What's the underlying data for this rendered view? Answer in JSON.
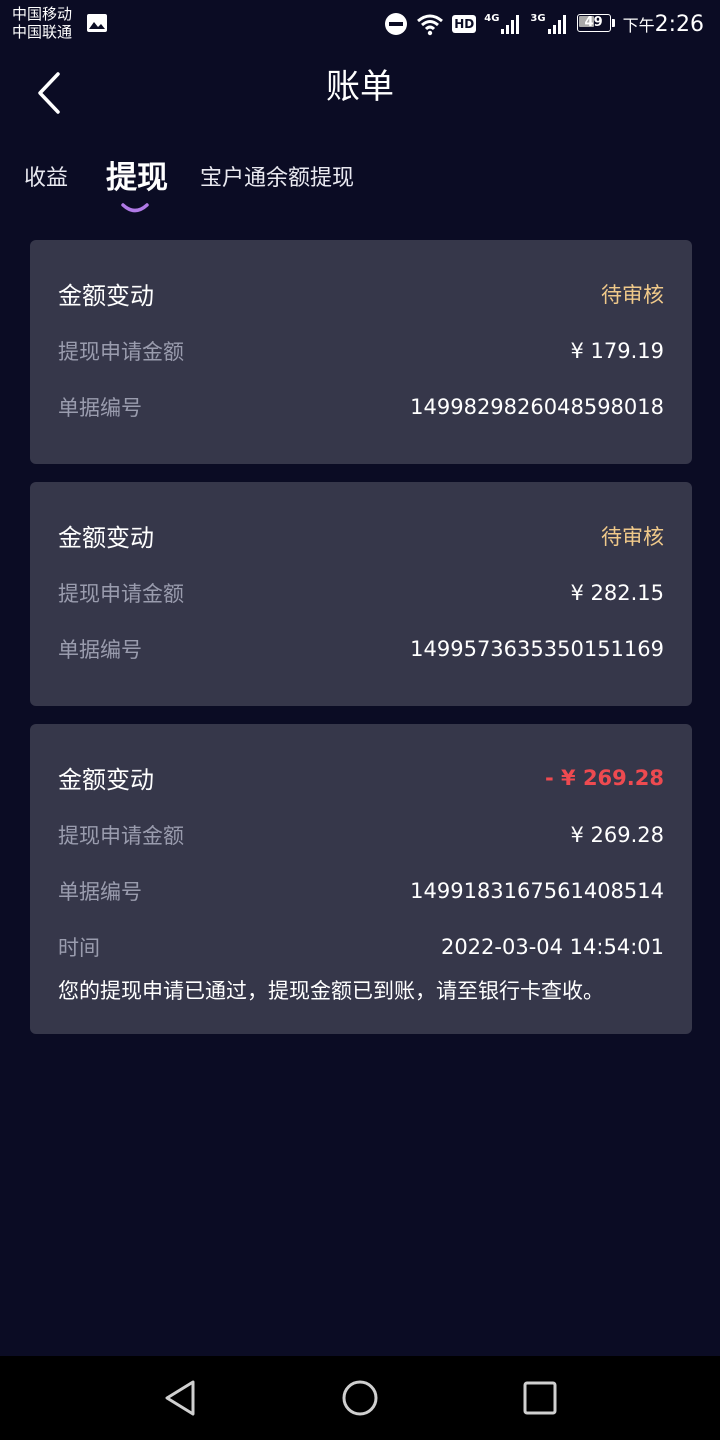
{
  "status_bar": {
    "carrier_1": "中国移动",
    "carrier_2": "中国联通",
    "hd": "HD",
    "net_1": "4G",
    "net_2": "3G",
    "battery": "49",
    "time_prefix": "下午",
    "time": "2:26"
  },
  "header": {
    "title": "账单"
  },
  "tabs": [
    {
      "label": "收益",
      "active": false
    },
    {
      "label": "提现",
      "active": true
    },
    {
      "label": "宝户通余额提现",
      "active": false
    }
  ],
  "records": [
    {
      "title": "金额变动",
      "status": "待审核",
      "amount_label": "提现申请金额",
      "amount": "¥ 179.19",
      "id_label": "单据编号",
      "id": "1499829826048598018"
    },
    {
      "title": "金额变动",
      "status": "待审核",
      "amount_label": "提现申请金额",
      "amount": "¥ 282.15",
      "id_label": "单据编号",
      "id": "1499573635350151169"
    },
    {
      "title": "金额变动",
      "status": "- ¥ 269.28",
      "amount_label": "提现申请金额",
      "amount": "¥ 269.28",
      "id_label": "单据编号",
      "id": "1499183167561408514",
      "time_label": "时间",
      "time": "2022-03-04 14:54:01",
      "note": "您的提现申请已通过，提现金额已到账，请至银行卡查收。"
    }
  ],
  "colors": {
    "background": "#0b0c24",
    "card": "#36374a",
    "pending": "#f0c98a",
    "negative": "#ee4a50",
    "tab_indicator": "#b07ae6"
  }
}
